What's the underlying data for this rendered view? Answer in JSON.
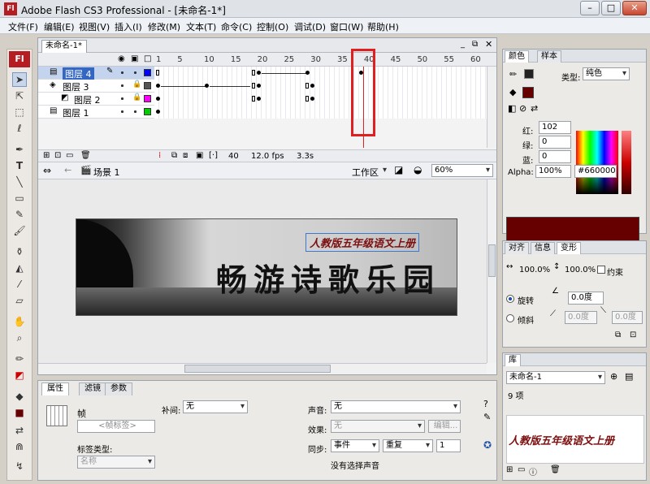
{
  "window": {
    "app_title": "Adobe Flash CS3 Professional - [未命名-1*]",
    "logo": "Fl",
    "controls": [
      "–",
      "□",
      "✕"
    ]
  },
  "menu": [
    "文件(F)",
    "编辑(E)",
    "视图(V)",
    "插入(I)",
    "修改(M)",
    "文本(T)",
    "命令(C)",
    "控制(O)",
    "调试(D)",
    "窗口(W)",
    "帮助(H)"
  ],
  "toolbox": {
    "badge": "Fl",
    "tools": [
      "arrow-icon",
      "subselect-icon",
      "free-transform-icon",
      "lasso-icon",
      "pen-icon",
      "text-icon",
      "line-icon",
      "rectangle-icon",
      "pencil-icon",
      "brush-icon",
      "ink-bottle-icon",
      "paint-bucket-icon",
      "eyedropper-icon",
      "eraser-icon",
      "hand-icon",
      "zoom-icon",
      "stroke-color-icon",
      "fill-color-icon"
    ]
  },
  "document": {
    "tab": "未命名-1*",
    "frame_numbers": [
      "1",
      "5",
      "10",
      "15",
      "20",
      "25",
      "30",
      "35",
      "40",
      "45",
      "50",
      "55",
      "60"
    ],
    "layers": [
      {
        "name": "图层 4",
        "color": "#0000ff",
        "active": true
      },
      {
        "name": "图层 3",
        "color": "#555555",
        "active": false
      },
      {
        "name": "图层 2",
        "color": "#ff00ff",
        "active": false
      },
      {
        "name": "图层 1",
        "color": "#00cc00",
        "active": false
      }
    ],
    "current_frame": "40",
    "fps": "12.0 fps",
    "elapsed": "3.3s",
    "scene": "场景 1",
    "workspace": "工作区",
    "zoom": "60%",
    "banner": {
      "subtitle": "人教版五年级语文上册",
      "title": "畅游诗歌乐园"
    }
  },
  "properties": {
    "tabs": [
      "属性",
      "滤镜",
      "参数"
    ],
    "type": "帧",
    "frame_label_placeholder": "<帧标签>",
    "label_type_label": "标签类型:",
    "label_type_value": "名称",
    "tween_label": "补间:",
    "tween_value": "无",
    "sound_label": "声音:",
    "sound_value": "无",
    "effect_label": "效果:",
    "effect_value": "无",
    "edit_button": "编辑...",
    "sync_label": "同步:",
    "sync_value": "事件",
    "repeat_value": "重复",
    "repeat_count": "1",
    "no_sound": "没有选择声音"
  },
  "color_panel": {
    "tabs": [
      "颜色",
      "样本"
    ],
    "type_label": "类型:",
    "type_value": "纯色",
    "r_label": "红:",
    "r": "102",
    "g_label": "绿:",
    "g": "0",
    "b_label": "蓝:",
    "b": "0",
    "alpha_label": "Alpha:",
    "alpha": "100%",
    "hex": "#660000",
    "fill_color": "#660000"
  },
  "transform_panel": {
    "tabs": [
      "对齐",
      "信息",
      "变形"
    ],
    "width": "100.0%",
    "height": "100.0%",
    "constrain": "约束",
    "rotate_label": "旋转",
    "rotate_value": "0.0度",
    "skew_label": "倾斜",
    "skew_h": "0.0度",
    "skew_v": "0.0度"
  },
  "library_panel": {
    "tab": "库",
    "document": "未命名-1",
    "count": "9 项",
    "preview_text": "人教版五年级语文上册"
  }
}
